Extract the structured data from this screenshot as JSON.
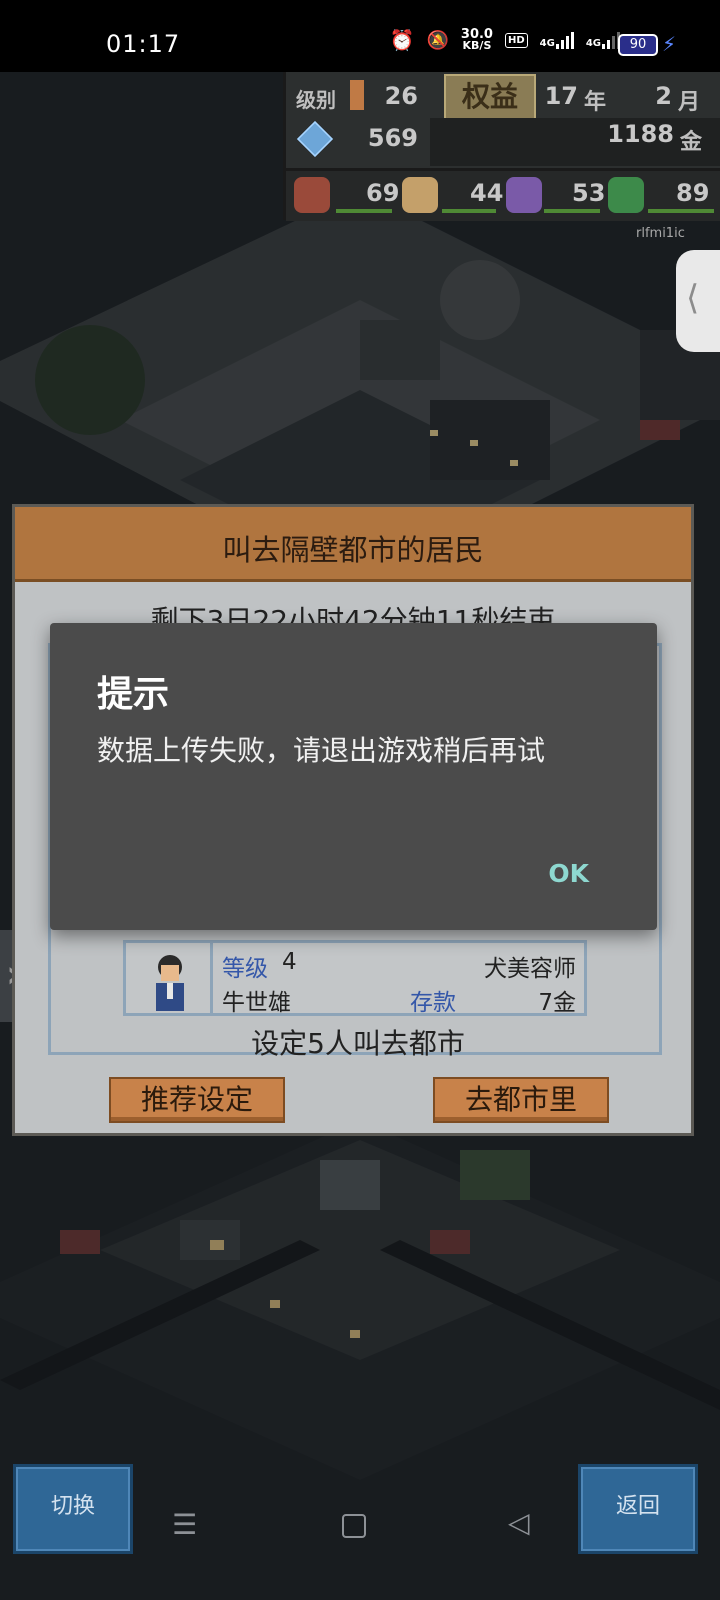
{
  "status_bar": {
    "time": "01:17",
    "net_speed": "30.0",
    "net_unit": "KB/S",
    "hd_label": "HD",
    "signal1": "4G",
    "signal2": "4G",
    "battery": "90"
  },
  "hud": {
    "rank_label": "级别",
    "rank_value": "26",
    "rights_button": "权益",
    "year": "17",
    "year_unit": "年",
    "month": "2",
    "month_unit": "月",
    "gems": "569",
    "gold": "1188",
    "gold_unit": "金",
    "stat_food": "69",
    "stat_goods": "44",
    "stat_music": "53",
    "stat_books": "89"
  },
  "watermark": "rlfmi1ic",
  "panel": {
    "title": "叫去隔壁都市的居民",
    "timer": "剩下3日22小时42分钟11秒结束",
    "resident": {
      "level_label": "等级",
      "level": "4",
      "job": "犬美容师",
      "name": "牛世雄",
      "savings_label": "存款",
      "savings": "7金"
    },
    "footer": "设定5人叫去都市",
    "btn_recommend": "推荐设定",
    "btn_go_city": "去都市里"
  },
  "dialog": {
    "title": "提示",
    "message": "数据上传失败，请退出游戏稍后再试",
    "ok": "OK"
  },
  "bottom": {
    "switch_label": "切换",
    "back_label": "返回"
  },
  "colors": {
    "accent_dialog_ok": "#8ed8d0",
    "panel_header": "#b0753f",
    "game_button_blue": "#2f6796"
  }
}
